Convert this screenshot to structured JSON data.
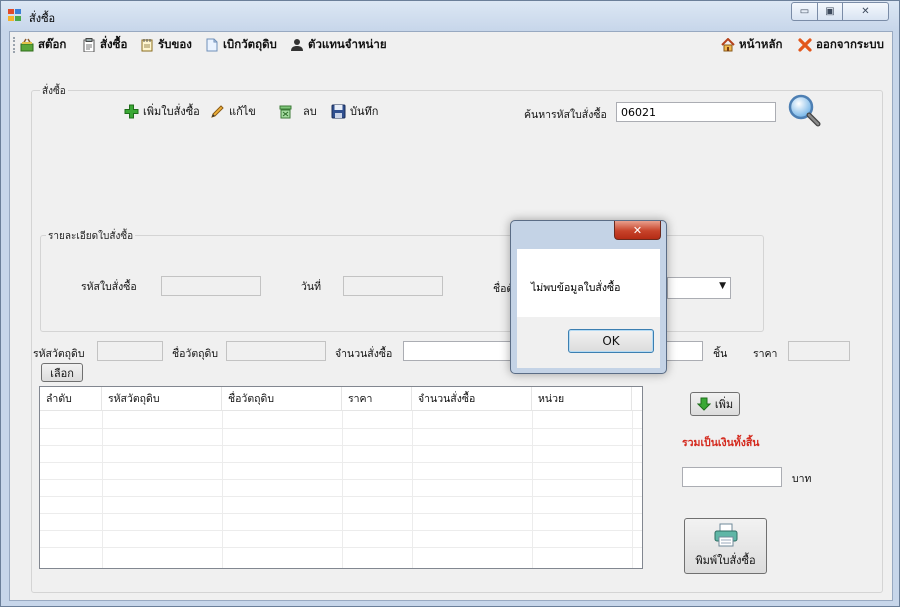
{
  "window": {
    "title": "สั่งซื้อ",
    "minimize_glyph": "▭",
    "maximize_glyph": "▣",
    "close_glyph": "✕"
  },
  "menu": {
    "items": [
      {
        "label": "สต๊อก",
        "icon": "basket-icon"
      },
      {
        "label": "สั่งซื้อ",
        "icon": "clipboard-icon"
      },
      {
        "label": "รับของ",
        "icon": "notepad-icon"
      },
      {
        "label": "เบิกวัตถุดิบ",
        "icon": "document-icon"
      },
      {
        "label": "ตัวแทนจำหน่าย",
        "icon": "person-icon"
      }
    ],
    "home_label": "หน้าหลัก",
    "logout_label": "ออกจากระบบ"
  },
  "order_group": {
    "title": "สั่งซื้อ",
    "add_label": "เพิ่มใบสั่งซื้อ",
    "edit_label": "แก้ไข",
    "delete_label": "ลบ",
    "save_label": "บันทึก",
    "search_label": "ค้นหารหัสใบสั่งซื้อ",
    "search_value": "06021"
  },
  "detail_group": {
    "title": "รายละเอียดใบสั่งซื้อ",
    "order_id_label": "รหัสใบสั่งซื้อ",
    "date_label": "วันที่",
    "supplier_label": "ชื่อตั"
  },
  "item_row": {
    "material_id_label": "รหัสวัตถุดิบ",
    "material_name_label": "ชื่อวัตถุดิบ",
    "qty_label": "จำนวนสั่งซื้อ",
    "unit_label": "ชิ้น",
    "price_label": "ราคา",
    "choose_label": "เลือก"
  },
  "grid": {
    "columns": [
      "ลำดับ",
      "รหัสวัตถุดิบ",
      "ชื่อวัตถุดิบ",
      "ราคา",
      "จำนวนสั่งซื้อ",
      "หน่วย"
    ]
  },
  "side": {
    "add_label": "เพิ่ม",
    "total_label": "รวมเป็นเงินทั้งสิ้น",
    "currency_label": "บาท",
    "print_label": "พิมพ์ใบสั่งซื้อ"
  },
  "dialog": {
    "message": "ไม่พบข้อมูลใบสั่งซื้อ",
    "ok_label": "OK",
    "close_glyph": "✕"
  },
  "colors": {
    "total_label": "#d42a1e",
    "accent_green": "#3aa835",
    "dialog_close": "#c7432a"
  }
}
